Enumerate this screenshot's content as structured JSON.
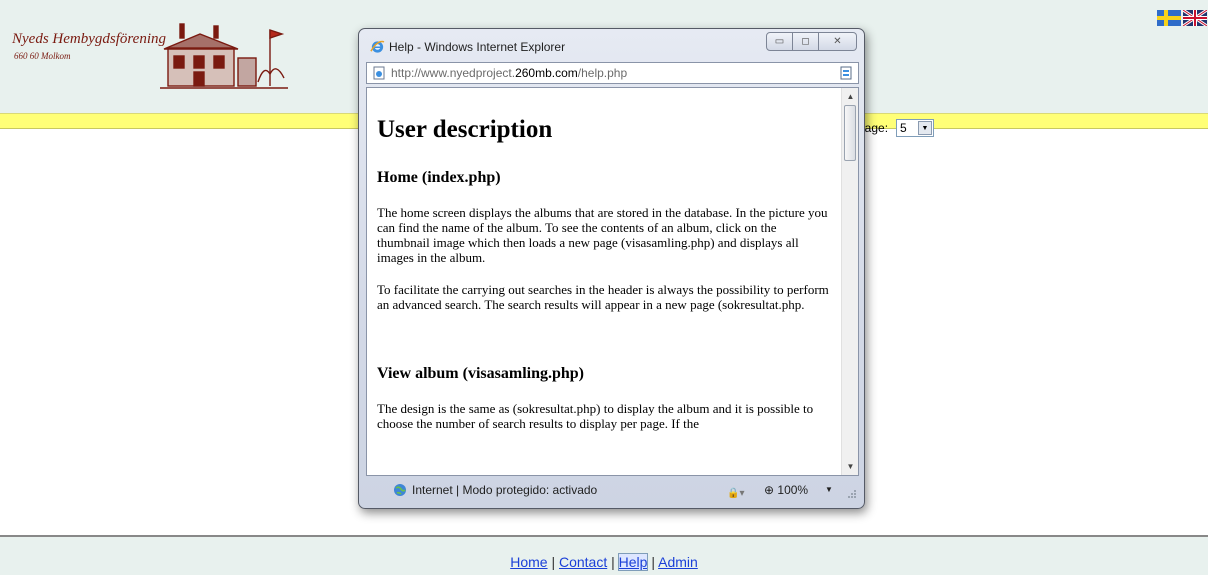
{
  "site": {
    "name": "Nyeds Hembygdsförening",
    "postal": "660 60 Molkom"
  },
  "per_page": {
    "label": "page:",
    "value": "5"
  },
  "footer": {
    "home": "Home",
    "sep": " | ",
    "contact": "Contact",
    "help": "Help",
    "admin": "Admin"
  },
  "popup": {
    "title": "Help - Windows Internet Explorer",
    "address_prefix": "http://www.nyedproject.",
    "address_domain": "260mb.com",
    "address_suffix": "/help.php",
    "heading": "User description",
    "section1_title": "Home (index.php)",
    "section1_p1": "The home screen displays the albums that are stored in the database. In the picture you can find the name of the album. To see the contents of an album, click on the thumbnail image which then loads a new page (visasamling.php) and displays all images in the album.",
    "section1_p2": "To facilitate the carrying out searches in the header is always the possibility to perform an advanced search. The search results will appear in a new page (sokresultat.php.",
    "section2_title": "View album (visasamling.php)",
    "section2_p1": "The design is the same as (sokresultat.php) to display the album and it is possible to choose the number of search results to display per page. If the",
    "status": "Internet | Modo protegido: activado",
    "zoom": "100%"
  },
  "colors": {
    "header_bg": "#e8f1ee",
    "yellow_bar": "#ffff77",
    "brand_red": "#7a1a10",
    "link_blue": "#1a3fd8"
  },
  "icons": [
    "house-logo",
    "swedish-flag-icon",
    "uk-flag-icon",
    "ie-icon",
    "page-icon",
    "compatibility-icon",
    "globe-icon",
    "lock-icon",
    "zoom-icon"
  ]
}
